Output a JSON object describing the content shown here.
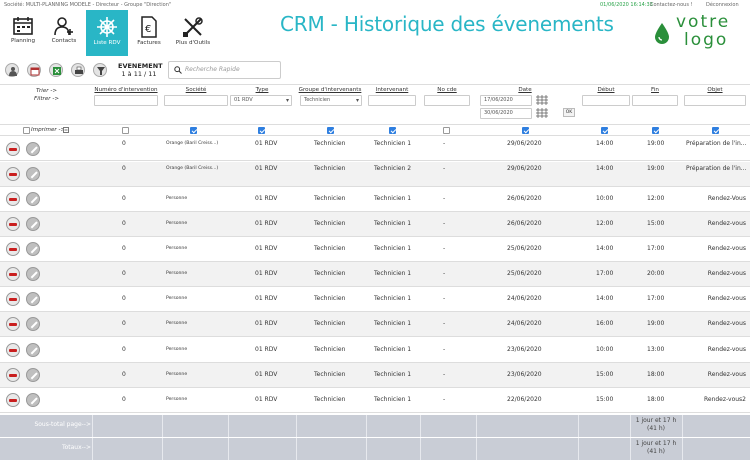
{
  "topbar": {
    "company": "Société: MULTI-PLANNING MODELE -   Directeur - Groupe \"Direction\"",
    "datetime": "01/06/2020 16:14:33",
    "contact": "Contactez-nous !",
    "logout": "Déconnexion"
  },
  "nav": [
    {
      "label": "Planning",
      "icon": "calendar-icon"
    },
    {
      "label": "Contacts",
      "icon": "add-user-icon"
    },
    {
      "label": "Liste RDV",
      "icon": "helm-icon",
      "active": true
    },
    {
      "label": "Factures",
      "icon": "invoice-icon"
    },
    {
      "label": "Plus d'Outils",
      "icon": "tools-icon"
    }
  ],
  "title": "CRM - Historique des évenements",
  "logo": {
    "line1": "votre",
    "line2": "logo"
  },
  "toolbar": {
    "icons": [
      "person-icon",
      "calendar-icon",
      "export-icon",
      "print-icon",
      "filter-icon"
    ],
    "event_label": "EVENEMENT",
    "event_count": "1 à 11 / 11",
    "search_placeholder": "Recherche Rapide"
  },
  "labels": {
    "sort": "Trier ->",
    "filter": "Filtrer ->",
    "print": "Imprimer ->"
  },
  "columns": [
    "Numéro d'intervention",
    "Société",
    "Type",
    "Groupe d'intervenants",
    "Intervenant",
    "No cde",
    "Date",
    "Début",
    "Fin",
    "Objet"
  ],
  "filters": {
    "type": "01 RDV",
    "groupe": "Technicien",
    "date_from": "17/06/2020",
    "date_to": "30/06/2020",
    "ok": "OK"
  },
  "rows": [
    {
      "num": "0",
      "societe": "Orange (Baril Creiss...)",
      "type": "01 RDV",
      "groupe": "Technicien",
      "intervenant": "Technicien 1",
      "nocde": "-",
      "date": "29/06/2020",
      "debut": "14:00",
      "fin": "19:00",
      "objet": "Préparation de l'in..."
    },
    {
      "num": "0",
      "societe": "Orange (Baril Creiss...)",
      "type": "01 RDV",
      "groupe": "Technicien",
      "intervenant": "Technicien 2",
      "nocde": "-",
      "date": "29/06/2020",
      "debut": "14:00",
      "fin": "19:00",
      "objet": "Préparation de l'in..."
    },
    {
      "num": "0",
      "societe": "Personne",
      "type": "01 RDV",
      "groupe": "Technicien",
      "intervenant": "Technicien 1",
      "nocde": "-",
      "date": "26/06/2020",
      "debut": "10:00",
      "fin": "12:00",
      "objet": "Rendez-Vous"
    },
    {
      "num": "0",
      "societe": "Personne",
      "type": "01 RDV",
      "groupe": "Technicien",
      "intervenant": "Technicien 1",
      "nocde": "-",
      "date": "26/06/2020",
      "debut": "12:00",
      "fin": "15:00",
      "objet": "Rendez-vous"
    },
    {
      "num": "0",
      "societe": "Personne",
      "type": "01 RDV",
      "groupe": "Technicien",
      "intervenant": "Technicien 1",
      "nocde": "-",
      "date": "25/06/2020",
      "debut": "14:00",
      "fin": "17:00",
      "objet": "Rendez-vous"
    },
    {
      "num": "0",
      "societe": "Personne",
      "type": "01 RDV",
      "groupe": "Technicien",
      "intervenant": "Technicien 1",
      "nocde": "-",
      "date": "25/06/2020",
      "debut": "17:00",
      "fin": "20:00",
      "objet": "Rendez-vous"
    },
    {
      "num": "0",
      "societe": "Personne",
      "type": "01 RDV",
      "groupe": "Technicien",
      "intervenant": "Technicien 1",
      "nocde": "-",
      "date": "24/06/2020",
      "debut": "14:00",
      "fin": "17:00",
      "objet": "Rendez-vous"
    },
    {
      "num": "0",
      "societe": "Personne",
      "type": "01 RDV",
      "groupe": "Technicien",
      "intervenant": "Technicien 1",
      "nocde": "-",
      "date": "24/06/2020",
      "debut": "16:00",
      "fin": "19:00",
      "objet": "Rendez-vous"
    },
    {
      "num": "0",
      "societe": "Personne",
      "type": "01 RDV",
      "groupe": "Technicien",
      "intervenant": "Technicien 1",
      "nocde": "-",
      "date": "23/06/2020",
      "debut": "10:00",
      "fin": "13:00",
      "objet": "Rendez-vous"
    },
    {
      "num": "0",
      "societe": "Personne",
      "type": "01 RDV",
      "groupe": "Technicien",
      "intervenant": "Technicien 1",
      "nocde": "-",
      "date": "23/06/2020",
      "debut": "15:00",
      "fin": "18:00",
      "objet": "Rendez-vous"
    },
    {
      "num": "0",
      "societe": "Personne",
      "type": "01 RDV",
      "groupe": "Technicien",
      "intervenant": "Technicien 1",
      "nocde": "-",
      "date": "22/06/2020",
      "debut": "15:00",
      "fin": "18:00",
      "objet": "Rendez-vous2"
    }
  ],
  "totals": {
    "subtotal_label": "Sous-total page-->",
    "total_label": "Totaux-->",
    "subtotal_fin": "1 jour et 17 h (41 h)",
    "total_fin": "1 jour et 17 h (41 h)"
  },
  "colors": {
    "accent": "#29b6c6",
    "logo": "#2a8f3a",
    "delete": "#c91f1f",
    "checkbox": "#2f7fe0"
  }
}
